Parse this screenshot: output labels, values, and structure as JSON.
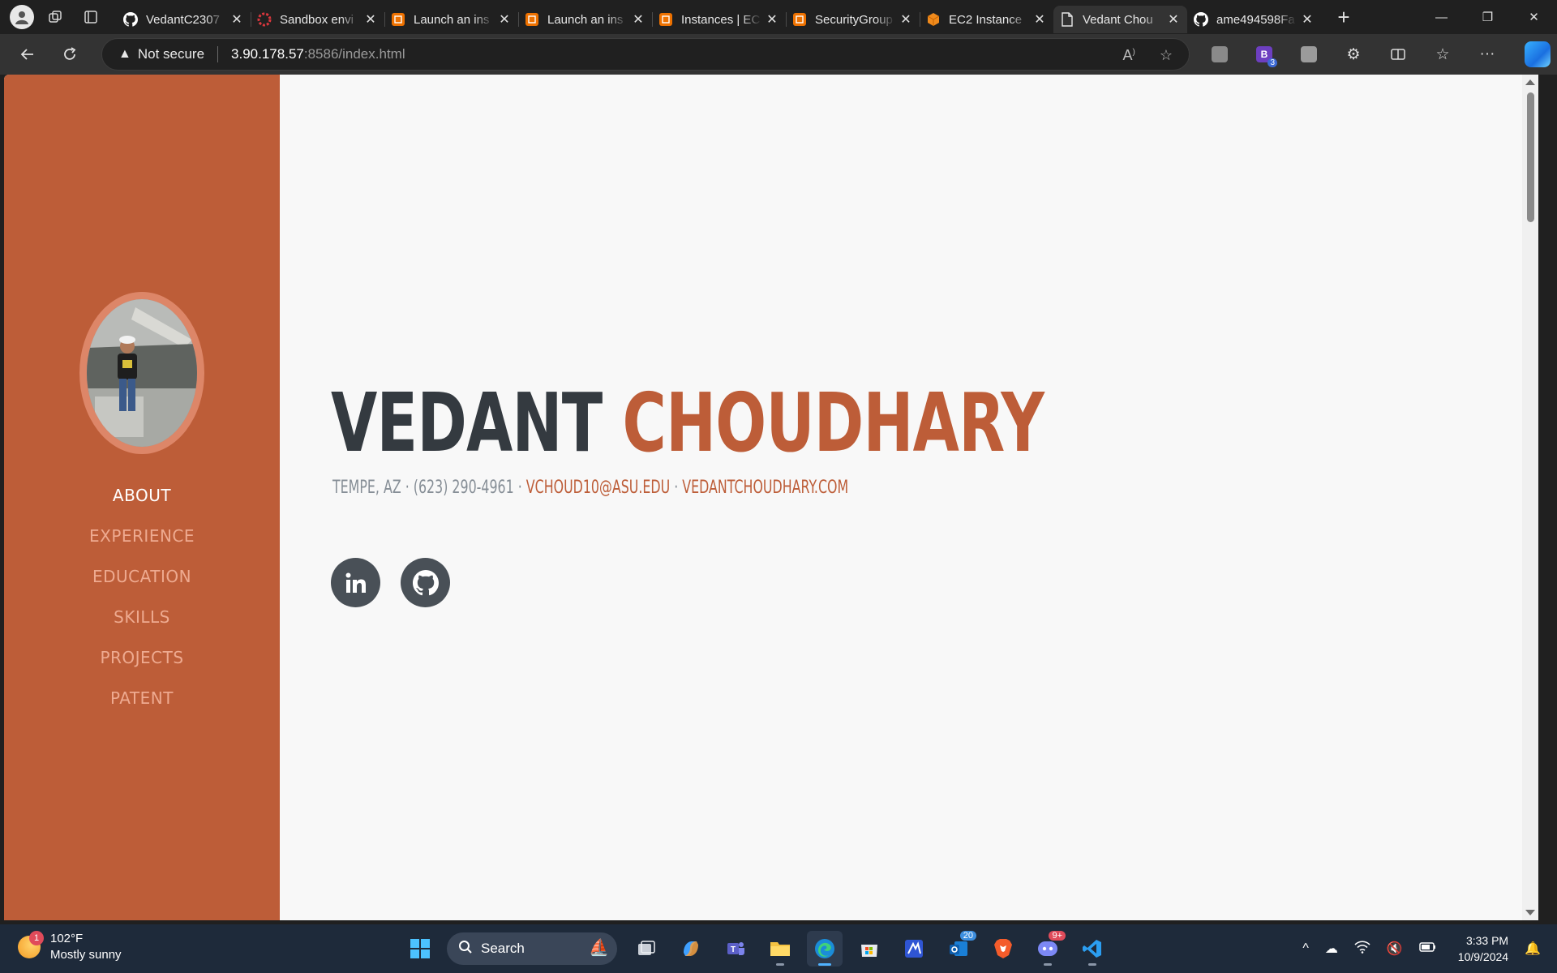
{
  "browser": {
    "tabs": [
      {
        "title": "VedantC2307",
        "icon": "github-icon",
        "active": false
      },
      {
        "title": "Sandbox envi",
        "icon": "sandbox-icon",
        "active": false
      },
      {
        "title": "Launch an ins",
        "icon": "aws-icon",
        "active": false
      },
      {
        "title": "Launch an ins",
        "icon": "aws-icon",
        "active": false
      },
      {
        "title": "Instances | EC",
        "icon": "aws-icon",
        "active": false
      },
      {
        "title": "SecurityGroup",
        "icon": "aws-icon",
        "active": false
      },
      {
        "title": "EC2 Instance",
        "icon": "aws-cube-icon",
        "active": false
      },
      {
        "title": "Vedant Chou",
        "icon": "page-icon",
        "active": true
      },
      {
        "title": "ame494598Fa",
        "icon": "github-icon",
        "active": false
      }
    ],
    "address": {
      "security": "Not secure",
      "host": "3.90.178.57",
      "path": ":8586/index.html"
    }
  },
  "page": {
    "nav": [
      {
        "label": "ABOUT",
        "active": true
      },
      {
        "label": "EXPERIENCE",
        "active": false
      },
      {
        "label": "EDUCATION",
        "active": false
      },
      {
        "label": "SKILLS",
        "active": false
      },
      {
        "label": "PROJECTS",
        "active": false
      },
      {
        "label": "PATENT",
        "active": false
      }
    ],
    "first_name": "VEDANT",
    "last_name": "CHOUDHARY",
    "contact": {
      "location": "TEMPE, AZ",
      "phone": "(623) 290-4961",
      "email": "VCHOUD10@ASU.EDU",
      "website": "VEDANTCHOUDHARY.COM",
      "separator": " · "
    },
    "social": [
      "linkedin-icon",
      "github-icon"
    ],
    "colors": {
      "primary": "#bd5d38",
      "dark": "#343a40",
      "muted": "#868e96"
    }
  },
  "taskbar": {
    "weather": {
      "temp": "102°F",
      "condition": "Mostly sunny",
      "badge": "1"
    },
    "search_label": "Search",
    "mail_badge": "20",
    "discord_badge": "9+",
    "time": "3:33 PM",
    "date": "10/9/2024"
  }
}
